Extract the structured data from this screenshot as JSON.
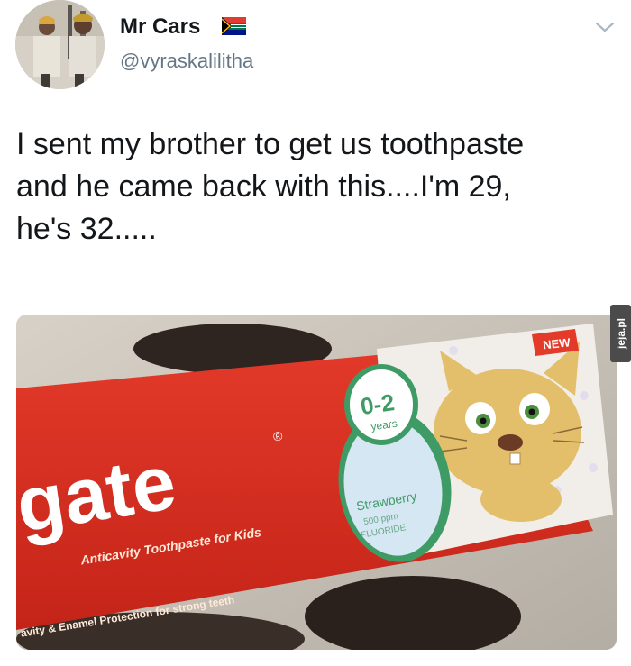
{
  "tweet": {
    "display_name": "Mr Cars",
    "handle": "@vyraskalilitha",
    "text_line1": "I sent my brother to get us toothpaste",
    "text_line2": "and he came back with this....I'm 29,",
    "text_line3": "he's 32.....",
    "flag_icon": "south-africa-flag-icon",
    "menu_icon": "chevron-down-icon"
  },
  "photo": {
    "badge_new": "NEW",
    "age_range": "0-2",
    "age_unit": "years",
    "brand": "gate",
    "registered": "®",
    "tagline": "Anticavity Toothpaste for Kids",
    "protection": "avity & Enamel Protection for strong teeth",
    "flavor": "Strawberry",
    "fluoride_amount": "500 ppm",
    "fluoride_label": "FLUORIDE"
  },
  "watermark": {
    "text": "jeja.pl"
  }
}
